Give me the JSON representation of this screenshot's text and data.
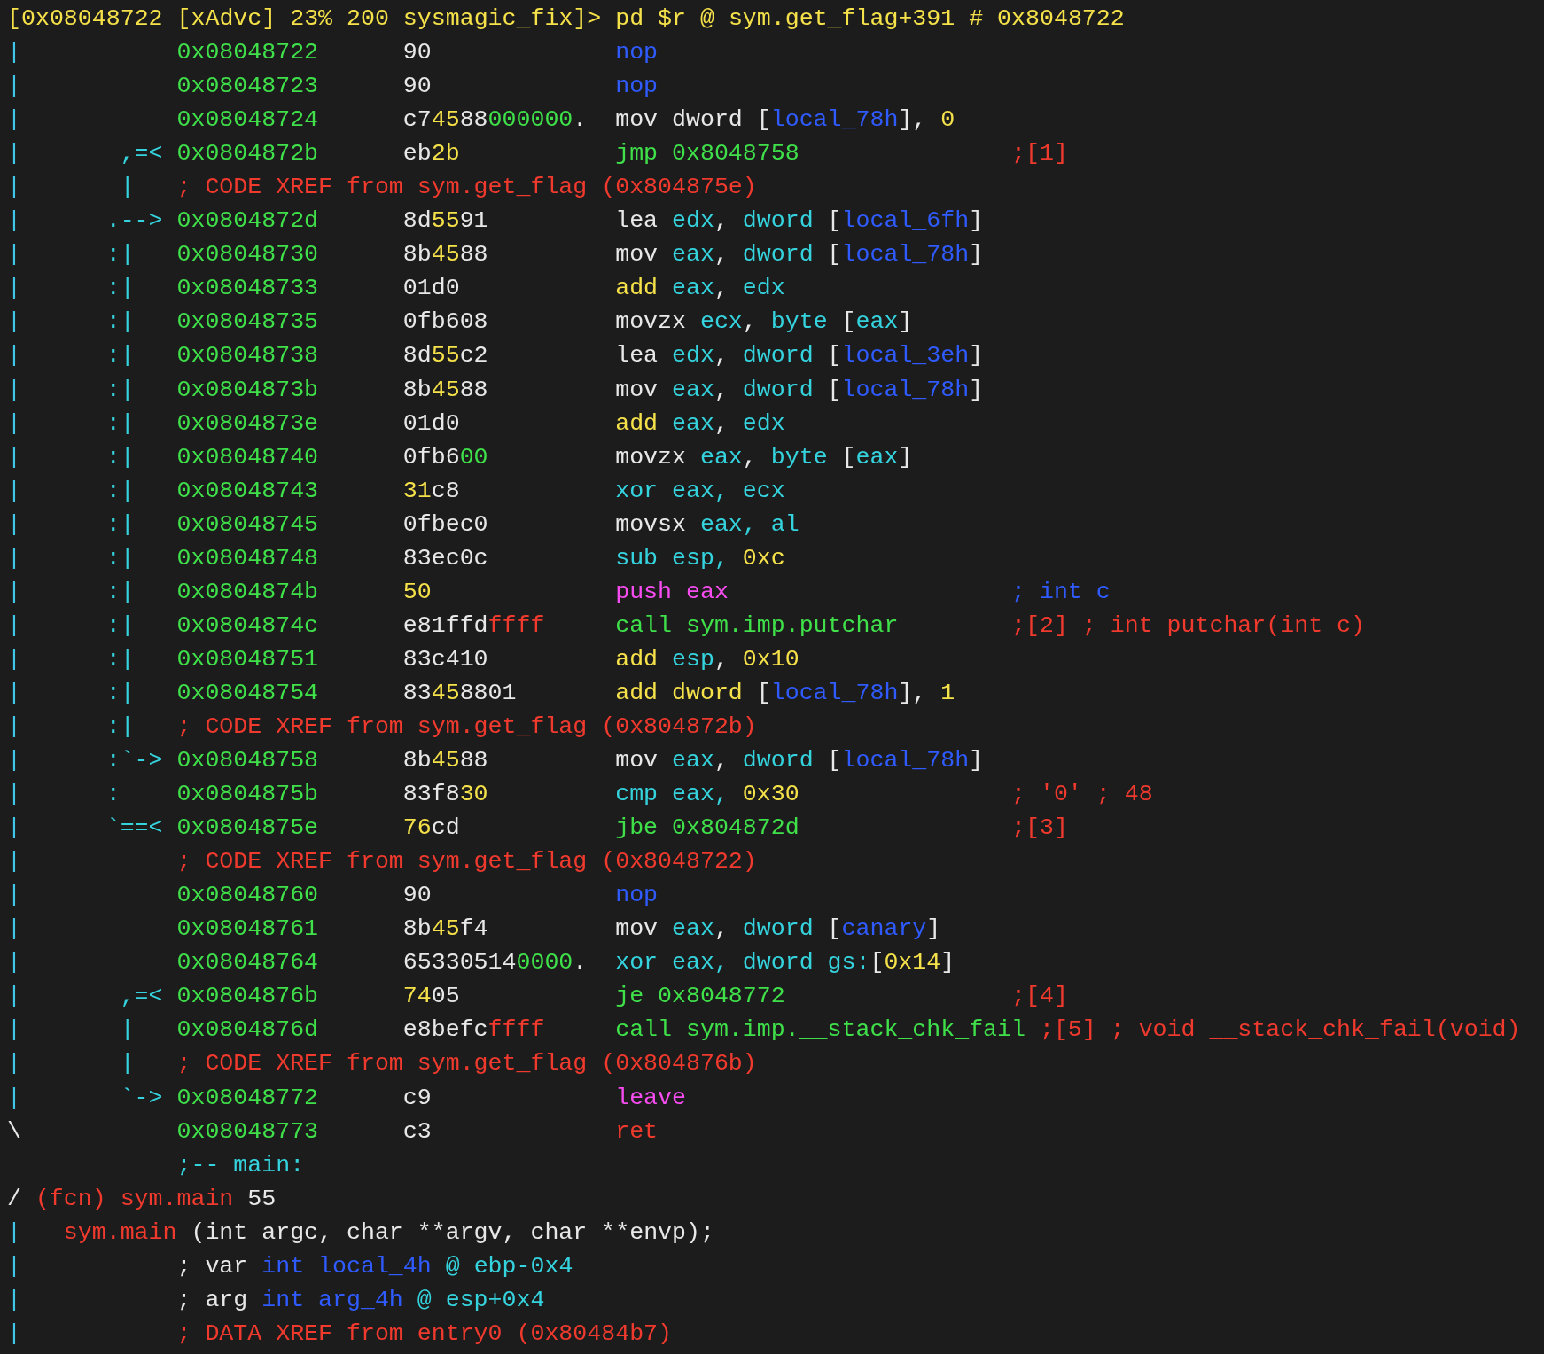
{
  "prompt": {
    "text": "[0x08048722 [xAdvc] 23% 200 sysmagic_fix]> pd $r @ sym.get_flag+391 # 0x8048722",
    "color": "#f5e14a"
  },
  "lines": [
    {
      "bar": {
        "text": "|",
        "color": "#3fc6e8"
      },
      "address": "0x08048722",
      "bytes": [
        {
          "text": "90",
          "color": "#e8e8e8"
        }
      ],
      "code": [
        {
          "text": "nop",
          "color": "#2f5bff"
        }
      ]
    },
    {
      "bar": {
        "text": "|",
        "color": "#3fc6e8"
      },
      "address": "0x08048723",
      "bytes": [
        {
          "text": "90",
          "color": "#e8e8e8"
        }
      ],
      "code": [
        {
          "text": "nop",
          "color": "#2f5bff"
        }
      ]
    },
    {
      "bar": {
        "text": "|",
        "color": "#3fc6e8"
      },
      "address": "0x08048724",
      "bytes": [
        {
          "text": "c7",
          "color": "#e8e8e8"
        },
        {
          "text": "45",
          "color": "#f5e14a"
        },
        {
          "text": "88",
          "color": "#e8e8e8"
        },
        {
          "text": "000000",
          "color": "#3fe04a"
        },
        {
          "text": ".",
          "color": "#e8e8e8"
        }
      ],
      "code": [
        {
          "text": "mov dword [",
          "color": "#e8e8e8"
        },
        {
          "text": "local_78h",
          "color": "#2f5bff"
        },
        {
          "text": "], ",
          "color": "#e8e8e8"
        },
        {
          "text": "0",
          "color": "#f5e14a"
        }
      ]
    },
    {
      "bar": {
        "text": "|",
        "color": "#3fc6e8"
      },
      "arrow": " ,=<",
      "address": "0x0804872b",
      "bytes": [
        {
          "text": "eb",
          "color": "#e8e8e8"
        },
        {
          "text": "2b",
          "color": "#f5e14a"
        }
      ],
      "code": [
        {
          "text": "jmp 0x8048758",
          "color": "#3fe04a"
        }
      ],
      "comment": [
        {
          "text": ";[1]",
          "color": "#f03a2e"
        }
      ]
    },
    {
      "bar": {
        "text": "|",
        "color": "#3fc6e8"
      },
      "arrow": " |",
      "note": [
        {
          "text": "; CODE XREF from sym.get_flag (0x804875e)",
          "color": "#f03a2e"
        }
      ]
    },
    {
      "bar": {
        "text": "|",
        "color": "#3fc6e8"
      },
      "arrow": ".-->",
      "address": "0x0804872d",
      "bytes": [
        {
          "text": "8d",
          "color": "#e8e8e8"
        },
        {
          "text": "55",
          "color": "#f5e14a"
        },
        {
          "text": "91",
          "color": "#e8e8e8"
        }
      ],
      "code": [
        {
          "text": "lea ",
          "color": "#e8e8e8"
        },
        {
          "text": "edx",
          "color": "#35d3de"
        },
        {
          "text": ", ",
          "color": "#e8e8e8"
        },
        {
          "text": "dword",
          "color": "#35d3de"
        },
        {
          "text": " [",
          "color": "#e8e8e8"
        },
        {
          "text": "local_6fh",
          "color": "#2f5bff"
        },
        {
          "text": "]",
          "color": "#e8e8e8"
        }
      ]
    },
    {
      "bar": {
        "text": "|",
        "color": "#3fc6e8"
      },
      "arrow": ":|",
      "address": "0x08048730",
      "bytes": [
        {
          "text": "8b",
          "color": "#e8e8e8"
        },
        {
          "text": "45",
          "color": "#f5e14a"
        },
        {
          "text": "88",
          "color": "#e8e8e8"
        }
      ],
      "code": [
        {
          "text": "mov ",
          "color": "#e8e8e8"
        },
        {
          "text": "eax",
          "color": "#35d3de"
        },
        {
          "text": ", ",
          "color": "#e8e8e8"
        },
        {
          "text": "dword",
          "color": "#35d3de"
        },
        {
          "text": " [",
          "color": "#e8e8e8"
        },
        {
          "text": "local_78h",
          "color": "#2f5bff"
        },
        {
          "text": "]",
          "color": "#e8e8e8"
        }
      ]
    },
    {
      "bar": {
        "text": "|",
        "color": "#3fc6e8"
      },
      "arrow": ":|",
      "address": "0x08048733",
      "bytes": [
        {
          "text": "01d0",
          "color": "#e8e8e8"
        }
      ],
      "code": [
        {
          "text": "add ",
          "color": "#f5e14a"
        },
        {
          "text": "eax",
          "color": "#35d3de"
        },
        {
          "text": ", ",
          "color": "#e8e8e8"
        },
        {
          "text": "edx",
          "color": "#35d3de"
        }
      ]
    },
    {
      "bar": {
        "text": "|",
        "color": "#3fc6e8"
      },
      "arrow": ":|",
      "address": "0x08048735",
      "bytes": [
        {
          "text": "0fb608",
          "color": "#e8e8e8"
        }
      ],
      "code": [
        {
          "text": "movzx ",
          "color": "#e8e8e8"
        },
        {
          "text": "ecx",
          "color": "#35d3de"
        },
        {
          "text": ", ",
          "color": "#e8e8e8"
        },
        {
          "text": "byte",
          "color": "#35d3de"
        },
        {
          "text": " [",
          "color": "#e8e8e8"
        },
        {
          "text": "eax",
          "color": "#35d3de"
        },
        {
          "text": "]",
          "color": "#e8e8e8"
        }
      ]
    },
    {
      "bar": {
        "text": "|",
        "color": "#3fc6e8"
      },
      "arrow": ":|",
      "address": "0x08048738",
      "bytes": [
        {
          "text": "8d",
          "color": "#e8e8e8"
        },
        {
          "text": "55",
          "color": "#f5e14a"
        },
        {
          "text": "c2",
          "color": "#e8e8e8"
        }
      ],
      "code": [
        {
          "text": "lea ",
          "color": "#e8e8e8"
        },
        {
          "text": "edx",
          "color": "#35d3de"
        },
        {
          "text": ", ",
          "color": "#e8e8e8"
        },
        {
          "text": "dword",
          "color": "#35d3de"
        },
        {
          "text": " [",
          "color": "#e8e8e8"
        },
        {
          "text": "local_3eh",
          "color": "#2f5bff"
        },
        {
          "text": "]",
          "color": "#e8e8e8"
        }
      ]
    },
    {
      "bar": {
        "text": "|",
        "color": "#3fc6e8"
      },
      "arrow": ":|",
      "address": "0x0804873b",
      "bytes": [
        {
          "text": "8b",
          "color": "#e8e8e8"
        },
        {
          "text": "45",
          "color": "#f5e14a"
        },
        {
          "text": "88",
          "color": "#e8e8e8"
        }
      ],
      "code": [
        {
          "text": "mov ",
          "color": "#e8e8e8"
        },
        {
          "text": "eax",
          "color": "#35d3de"
        },
        {
          "text": ", ",
          "color": "#e8e8e8"
        },
        {
          "text": "dword",
          "color": "#35d3de"
        },
        {
          "text": " [",
          "color": "#e8e8e8"
        },
        {
          "text": "local_78h",
          "color": "#2f5bff"
        },
        {
          "text": "]",
          "color": "#e8e8e8"
        }
      ]
    },
    {
      "bar": {
        "text": "|",
        "color": "#3fc6e8"
      },
      "arrow": ":|",
      "address": "0x0804873e",
      "bytes": [
        {
          "text": "01d0",
          "color": "#e8e8e8"
        }
      ],
      "code": [
        {
          "text": "add ",
          "color": "#f5e14a"
        },
        {
          "text": "eax",
          "color": "#35d3de"
        },
        {
          "text": ", ",
          "color": "#e8e8e8"
        },
        {
          "text": "edx",
          "color": "#35d3de"
        }
      ]
    },
    {
      "bar": {
        "text": "|",
        "color": "#3fc6e8"
      },
      "arrow": ":|",
      "address": "0x08048740",
      "bytes": [
        {
          "text": "0fb6",
          "color": "#e8e8e8"
        },
        {
          "text": "00",
          "color": "#3fe04a"
        }
      ],
      "code": [
        {
          "text": "movzx ",
          "color": "#e8e8e8"
        },
        {
          "text": "eax",
          "color": "#35d3de"
        },
        {
          "text": ", ",
          "color": "#e8e8e8"
        },
        {
          "text": "byte",
          "color": "#35d3de"
        },
        {
          "text": " [",
          "color": "#e8e8e8"
        },
        {
          "text": "eax",
          "color": "#35d3de"
        },
        {
          "text": "]",
          "color": "#e8e8e8"
        }
      ]
    },
    {
      "bar": {
        "text": "|",
        "color": "#3fc6e8"
      },
      "arrow": ":|",
      "address": "0x08048743",
      "bytes": [
        {
          "text": "31",
          "color": "#f5e14a"
        },
        {
          "text": "c8",
          "color": "#e8e8e8"
        }
      ],
      "code": [
        {
          "text": "xor eax, ecx",
          "color": "#35d3de"
        }
      ]
    },
    {
      "bar": {
        "text": "|",
        "color": "#3fc6e8"
      },
      "arrow": ":|",
      "address": "0x08048745",
      "bytes": [
        {
          "text": "0fbec0",
          "color": "#e8e8e8"
        }
      ],
      "code": [
        {
          "text": "movsx ",
          "color": "#e8e8e8"
        },
        {
          "text": "eax, al",
          "color": "#35d3de"
        }
      ]
    },
    {
      "bar": {
        "text": "|",
        "color": "#3fc6e8"
      },
      "arrow": ":|",
      "address": "0x08048748",
      "bytes": [
        {
          "text": "83ec0c",
          "color": "#e8e8e8"
        }
      ],
      "code": [
        {
          "text": "sub esp, ",
          "color": "#35d3de"
        },
        {
          "text": "0xc",
          "color": "#f5e14a"
        }
      ]
    },
    {
      "bar": {
        "text": "|",
        "color": "#3fc6e8"
      },
      "arrow": ":|",
      "address": "0x0804874b",
      "bytes": [
        {
          "text": "50",
          "color": "#f5e14a"
        }
      ],
      "code": [
        {
          "text": "push eax",
          "color": "#f64cf0"
        }
      ],
      "comment": [
        {
          "text": "; int c",
          "color": "#2f5bff"
        }
      ]
    },
    {
      "bar": {
        "text": "|",
        "color": "#3fc6e8"
      },
      "arrow": ":|",
      "address": "0x0804874c",
      "bytes": [
        {
          "text": "e81ffd",
          "color": "#e8e8e8"
        },
        {
          "text": "ffff",
          "color": "#f03a2e"
        }
      ],
      "code": [
        {
          "text": "call sym.imp.putchar",
          "color": "#3fe04a"
        }
      ],
      "comment": [
        {
          "text": ";[2] ; int putchar(int c)",
          "color": "#f03a2e"
        }
      ]
    },
    {
      "bar": {
        "text": "|",
        "color": "#3fc6e8"
      },
      "arrow": ":|",
      "address": "0x08048751",
      "bytes": [
        {
          "text": "83c410",
          "color": "#e8e8e8"
        }
      ],
      "code": [
        {
          "text": "add ",
          "color": "#f5e14a"
        },
        {
          "text": "esp",
          "color": "#35d3de"
        },
        {
          "text": ", ",
          "color": "#e8e8e8"
        },
        {
          "text": "0x10",
          "color": "#f5e14a"
        }
      ]
    },
    {
      "bar": {
        "text": "|",
        "color": "#3fc6e8"
      },
      "arrow": ":|",
      "address": "0x08048754",
      "bytes": [
        {
          "text": "83",
          "color": "#e8e8e8"
        },
        {
          "text": "45",
          "color": "#f5e14a"
        },
        {
          "text": "8801",
          "color": "#e8e8e8"
        }
      ],
      "code": [
        {
          "text": "add dword ",
          "color": "#f5e14a"
        },
        {
          "text": "[",
          "color": "#e8e8e8"
        },
        {
          "text": "local_78h",
          "color": "#2f5bff"
        },
        {
          "text": "], ",
          "color": "#e8e8e8"
        },
        {
          "text": "1",
          "color": "#f5e14a"
        }
      ]
    },
    {
      "bar": {
        "text": "|",
        "color": "#3fc6e8"
      },
      "arrow": ":|",
      "note": [
        {
          "text": "; CODE XREF from sym.get_flag (0x804872b)",
          "color": "#f03a2e"
        }
      ]
    },
    {
      "bar": {
        "text": "|",
        "color": "#3fc6e8"
      },
      "arrow": ":`->",
      "address": "0x08048758",
      "bytes": [
        {
          "text": "8b",
          "color": "#e8e8e8"
        },
        {
          "text": "45",
          "color": "#f5e14a"
        },
        {
          "text": "88",
          "color": "#e8e8e8"
        }
      ],
      "code": [
        {
          "text": "mov ",
          "color": "#e8e8e8"
        },
        {
          "text": "eax",
          "color": "#35d3de"
        },
        {
          "text": ", ",
          "color": "#e8e8e8"
        },
        {
          "text": "dword",
          "color": "#35d3de"
        },
        {
          "text": " [",
          "color": "#e8e8e8"
        },
        {
          "text": "local_78h",
          "color": "#2f5bff"
        },
        {
          "text": "]",
          "color": "#e8e8e8"
        }
      ]
    },
    {
      "bar": {
        "text": "|",
        "color": "#3fc6e8"
      },
      "arrow": ":",
      "address": "0x0804875b",
      "bytes": [
        {
          "text": "83f8",
          "color": "#e8e8e8"
        },
        {
          "text": "30",
          "color": "#f5e14a"
        }
      ],
      "code": [
        {
          "text": "cmp eax, ",
          "color": "#35d3de"
        },
        {
          "text": "0x30",
          "color": "#f5e14a"
        }
      ],
      "comment": [
        {
          "text": "; '0' ; 48",
          "color": "#f03a2e"
        }
      ]
    },
    {
      "bar": {
        "text": "|",
        "color": "#3fc6e8"
      },
      "arrow": "`==<",
      "address": "0x0804875e",
      "bytes": [
        {
          "text": "76",
          "color": "#f5e14a"
        },
        {
          "text": "cd",
          "color": "#e8e8e8"
        }
      ],
      "code": [
        {
          "text": "jbe 0x804872d",
          "color": "#3fe04a"
        }
      ],
      "comment": [
        {
          "text": ";[3]",
          "color": "#f03a2e"
        }
      ]
    },
    {
      "bar": {
        "text": "|",
        "color": "#3fc6e8"
      },
      "note": [
        {
          "text": "; CODE XREF from sym.get_flag (0x8048722)",
          "color": "#f03a2e"
        }
      ]
    },
    {
      "bar": {
        "text": "|",
        "color": "#3fc6e8"
      },
      "address": "0x08048760",
      "bytes": [
        {
          "text": "90",
          "color": "#e8e8e8"
        }
      ],
      "code": [
        {
          "text": "nop",
          "color": "#2f5bff"
        }
      ]
    },
    {
      "bar": {
        "text": "|",
        "color": "#3fc6e8"
      },
      "address": "0x08048761",
      "bytes": [
        {
          "text": "8b",
          "color": "#e8e8e8"
        },
        {
          "text": "45",
          "color": "#f5e14a"
        },
        {
          "text": "f4",
          "color": "#e8e8e8"
        }
      ],
      "code": [
        {
          "text": "mov ",
          "color": "#e8e8e8"
        },
        {
          "text": "eax",
          "color": "#35d3de"
        },
        {
          "text": ", ",
          "color": "#e8e8e8"
        },
        {
          "text": "dword",
          "color": "#35d3de"
        },
        {
          "text": " [",
          "color": "#e8e8e8"
        },
        {
          "text": "canary",
          "color": "#2f5bff"
        },
        {
          "text": "]",
          "color": "#e8e8e8"
        }
      ]
    },
    {
      "bar": {
        "text": "|",
        "color": "#3fc6e8"
      },
      "address": "0x08048764",
      "bytes": [
        {
          "text": "65330514",
          "color": "#e8e8e8"
        },
        {
          "text": "0000",
          "color": "#3fe04a"
        },
        {
          "text": ".",
          "color": "#e8e8e8"
        }
      ],
      "code": [
        {
          "text": "xor eax, dword gs:",
          "color": "#35d3de"
        },
        {
          "text": "[",
          "color": "#e8e8e8"
        },
        {
          "text": "0x14",
          "color": "#f5e14a"
        },
        {
          "text": "]",
          "color": "#e8e8e8"
        }
      ]
    },
    {
      "bar": {
        "text": "|",
        "color": "#3fc6e8"
      },
      "arrow": " ,=<",
      "address": "0x0804876b",
      "bytes": [
        {
          "text": "74",
          "color": "#f5e14a"
        },
        {
          "text": "05",
          "color": "#e8e8e8"
        }
      ],
      "code": [
        {
          "text": "je 0x8048772",
          "color": "#3fe04a"
        }
      ],
      "comment": [
        {
          "text": ";[4]",
          "color": "#f03a2e"
        }
      ]
    },
    {
      "bar": {
        "text": "|",
        "color": "#3fc6e8"
      },
      "arrow": " |",
      "address": "0x0804876d",
      "bytes": [
        {
          "text": "e8befc",
          "color": "#e8e8e8"
        },
        {
          "text": "ffff",
          "color": "#f03a2e"
        }
      ],
      "code": [
        {
          "text": "call sym.imp.__stack_chk_fail",
          "color": "#3fe04a"
        }
      ],
      "comment": [
        {
          "text": ";[5] ; void __stack_chk_fail(void)",
          "color": "#f03a2e"
        }
      ]
    },
    {
      "bar": {
        "text": "|",
        "color": "#3fc6e8"
      },
      "arrow": " |",
      "note": [
        {
          "text": "; CODE XREF from sym.get_flag (0x804876b)",
          "color": "#f03a2e"
        }
      ]
    },
    {
      "bar": {
        "text": "|",
        "color": "#3fc6e8"
      },
      "arrow": " `->",
      "address": "0x08048772",
      "bytes": [
        {
          "text": "c9",
          "color": "#e8e8e8"
        }
      ],
      "code": [
        {
          "text": "leave",
          "color": "#f64cf0"
        }
      ]
    },
    {
      "bar": {
        "text": "\\",
        "color": "#e8e8e8"
      },
      "address": "0x08048773",
      "bytes": [
        {
          "text": "c3",
          "color": "#e8e8e8"
        }
      ],
      "code": [
        {
          "text": "ret",
          "color": "#f03a2e"
        }
      ]
    },
    {
      "note": [
        {
          "text": ";-- main:",
          "color": "#35d3de"
        }
      ]
    },
    {
      "bar": {
        "text": "/",
        "color": "#e8e8e8"
      },
      "title": [
        {
          "text": "(fcn) sym.main ",
          "color": "#f03a2e"
        },
        {
          "text": "55",
          "color": "#e8e8e8"
        }
      ]
    },
    {
      "bar": {
        "text": "|",
        "color": "#3fc6e8"
      },
      "signature": [
        {
          "text": "sym.main",
          "color": "#f03a2e"
        },
        {
          "text": " (int argc, char **argv, char **envp);",
          "color": "#e8e8e8"
        }
      ]
    },
    {
      "bar": {
        "text": "|",
        "color": "#3fc6e8"
      },
      "note": [
        {
          "text": "; var ",
          "color": "#e8e8e8"
        },
        {
          "text": "int local_4h",
          "color": "#2f5bff"
        },
        {
          "text": " @ ebp-0x4",
          "color": "#35d3de"
        }
      ]
    },
    {
      "bar": {
        "text": "|",
        "color": "#3fc6e8"
      },
      "note": [
        {
          "text": "; arg ",
          "color": "#e8e8e8"
        },
        {
          "text": "int arg_4h",
          "color": "#2f5bff"
        },
        {
          "text": " @ esp+0x4",
          "color": "#35d3de"
        }
      ]
    },
    {
      "bar": {
        "text": "|",
        "color": "#3fc6e8"
      },
      "note": [
        {
          "text": "; DATA XREF from entry0 (0x80484b7)",
          "color": "#f03a2e"
        }
      ]
    }
  ]
}
